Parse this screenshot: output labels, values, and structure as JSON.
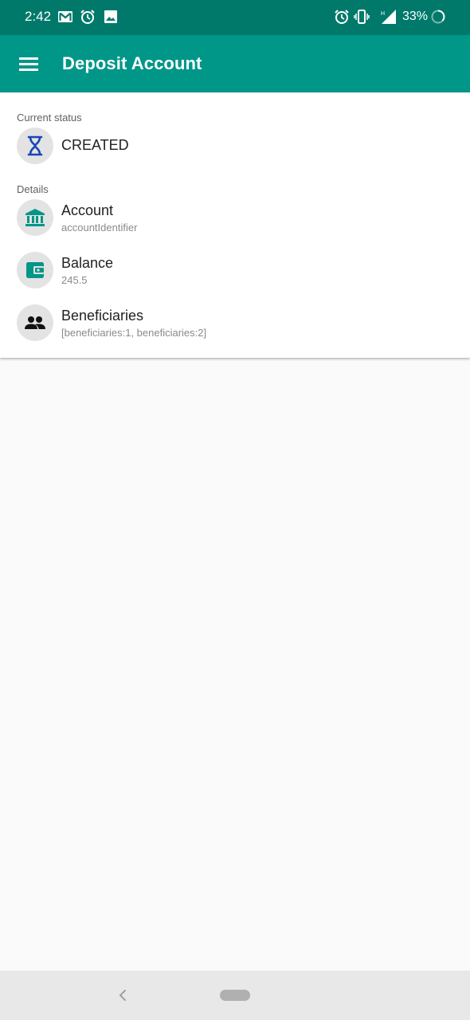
{
  "status_bar": {
    "time": "2:42",
    "battery": "33%",
    "icons": [
      "gmail-icon",
      "alarm-icon",
      "image-icon",
      "alarm-icon",
      "vibrate-icon",
      "signal-icon",
      "battery-icon"
    ]
  },
  "app_bar": {
    "title": "Deposit Account",
    "menu_icon": "menu-icon",
    "color": "#009688"
  },
  "status_section": {
    "label": "Current status",
    "value": "CREATED",
    "icon": "hourglass-icon"
  },
  "details_section": {
    "label": "Details",
    "items": [
      {
        "title": "Account",
        "value": "accountIdentifier",
        "icon": "bank-icon"
      },
      {
        "title": "Balance",
        "value": "245.5",
        "icon": "wallet-icon"
      },
      {
        "title": "Beneficiaries",
        "value": "[beneficiaries:1, beneficiaries:2]",
        "icon": "people-icon"
      }
    ]
  },
  "colors": {
    "status_bar": "#00796b",
    "accent": "#009688",
    "hourglass": "#1a46b8"
  }
}
